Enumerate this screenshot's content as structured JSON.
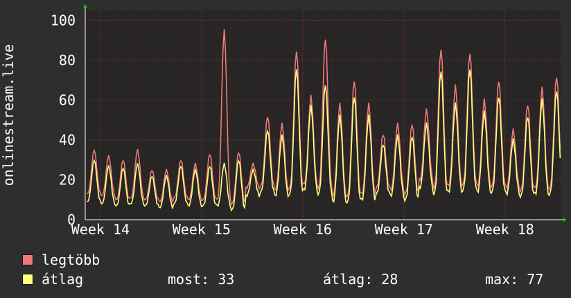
{
  "colors": {
    "background": "#2e2e2e",
    "plot_background": "#262626",
    "grid_minor": "#5a1e1e",
    "grid_major": "#7a2a2a",
    "max_series": "#f0787a",
    "avg_series": "#ffff80",
    "axis_arrow": "#00cc00"
  },
  "chart_data": {
    "type": "line",
    "ylabel": "onlinestream.live",
    "ylim": [
      0,
      105
    ],
    "yticks": [
      0,
      20,
      40,
      60,
      80,
      100
    ],
    "x_unit": "week",
    "xlim": [
      13.85,
      18.55
    ],
    "xticks": [
      {
        "value": 14,
        "label": "Week 14"
      },
      {
        "value": 15,
        "label": "Week 15"
      },
      {
        "value": 16,
        "label": "Week 16"
      },
      {
        "value": 17,
        "label": "Week 17"
      },
      {
        "value": 18,
        "label": "Week 18"
      }
    ],
    "grid": true,
    "series": [
      {
        "name": "legtöbb",
        "color": "#f0787a",
        "daily_peaks": [
          35,
          32,
          30,
          35,
          25,
          25,
          30,
          28,
          33,
          95,
          34,
          28,
          52,
          48,
          85,
          62,
          91,
          58,
          70,
          58,
          43,
          48,
          48,
          55,
          86,
          67,
          84,
          60,
          70,
          45,
          58,
          66,
          72,
          74,
          56,
          45,
          51
        ],
        "daily_troughs": [
          13,
          12,
          10,
          11,
          10,
          9,
          11,
          10,
          10,
          10,
          8,
          16,
          17,
          15,
          16,
          18,
          16,
          12,
          12,
          13,
          16,
          15,
          13,
          20,
          16,
          17,
          18,
          17,
          17,
          16,
          15,
          16,
          16,
          17,
          16,
          15,
          16
        ]
      },
      {
        "name": "átlag",
        "color": "#ffff80",
        "daily_peaks": [
          30,
          27,
          26,
          28,
          22,
          22,
          27,
          25,
          27,
          28,
          30,
          25,
          45,
          42,
          76,
          57,
          68,
          52,
          62,
          52,
          38,
          42,
          42,
          48,
          75,
          58,
          76,
          54,
          62,
          40,
          52,
          60,
          65,
          66,
          50,
          40,
          46
        ],
        "daily_troughs": [
          9,
          8,
          7,
          8,
          7,
          6,
          8,
          7,
          7,
          7,
          5,
          12,
          14,
          12,
          13,
          15,
          13,
          9,
          9,
          10,
          13,
          12,
          10,
          16,
          13,
          14,
          15,
          14,
          14,
          13,
          12,
          13,
          13,
          14,
          13,
          12,
          13
        ]
      }
    ]
  },
  "legend": {
    "items": [
      {
        "label": "legtöbb",
        "color": "#f0787a"
      },
      {
        "label": "átlag",
        "color": "#ffff80"
      }
    ],
    "stats": {
      "now": "most: 33",
      "avg": "átlag: 28",
      "max": "max: 77"
    }
  }
}
